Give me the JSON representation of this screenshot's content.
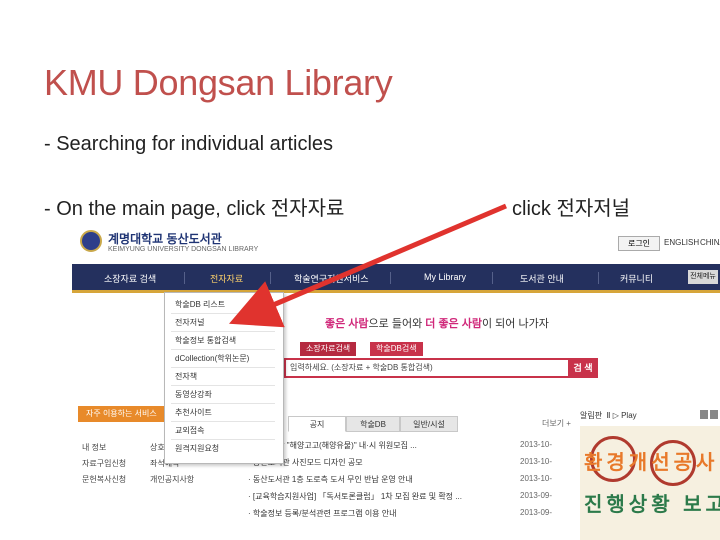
{
  "slide": {
    "title": "KMU Dongsan Library",
    "bullet1": "- Searching for individual articles",
    "bullet2": "- On the main page, click 전자자료",
    "bullet3": "click 전자저널"
  },
  "site": {
    "logo_text": "계명대학교 동산도서관",
    "logo_sub": "KEIMYUNG UNIVERSITY DONGSAN LIBRARY",
    "util": [
      "로그인",
      "ENGLISH",
      "CHINA"
    ],
    "nav": [
      "소장자료 검색",
      "전자자료",
      "학술연구지원서비스",
      "My Library",
      "도서관 안내",
      "커뮤니티",
      "전체메뉴"
    ],
    "active_nav": "전자자료",
    "dropdown": [
      "학술DB 리스트",
      "전자저널",
      "학술정보 통합검색",
      "dCollection(학위논문)",
      "전자책",
      "동영상강좌",
      "추천사이트",
      "교외접속",
      "원격지원요청"
    ],
    "slogan_pre": "좋은 사람",
    "slogan_mid": "으로 들어와 ",
    "slogan_pink2": "더 좋은 사람",
    "slogan_post": "이 되어 나가자",
    "search_tabs": [
      "소장자료검색",
      "학술DB검색"
    ],
    "search_placeholder": "입력하세요. (소장자료 + 학술DB 통합검색)",
    "search_button": "검 색",
    "quick_title": "자주 이용하는 서비스",
    "quick_items": [
      "내 정보",
      "자료구입신청",
      "문헌복사신청",
      "상호대차",
      "좌석예약",
      "개인공지사항"
    ],
    "news_tabs": [
      "공지",
      "학술DB",
      "일반/시설"
    ],
    "more": "더보기 +",
    "news": [
      {
        "title": "· 공지 소장 \"해양고고(해양유물)\" 내·시 위원모집 ...",
        "date": "2013-10-"
      },
      {
        "title": "· 동산도서관 사진모드 디자인 공모",
        "date": "2013-10-"
      },
      {
        "title": "· 동산도서관 1층 도로측 도서 무인 반납 운영 안내",
        "date": "2013-10-"
      },
      {
        "title": "· [교육학습지원사업] 「독서토론클럽」 1차 모집 완료 및 확정 ...",
        "date": "2013-09-"
      },
      {
        "title": "· 학술정보 등록/분석관련 프로그램 이용 안내",
        "date": "2013-09-"
      }
    ],
    "alarm_title": "알림판",
    "alarm_play": "Play",
    "banner_line1": "환경개선공사",
    "banner_line2": "진행상황 보고"
  },
  "colors": {
    "title": "#c0504d",
    "nav_bg": "#24305e",
    "accent": "#c8324a",
    "arrow": "#e0332e"
  }
}
